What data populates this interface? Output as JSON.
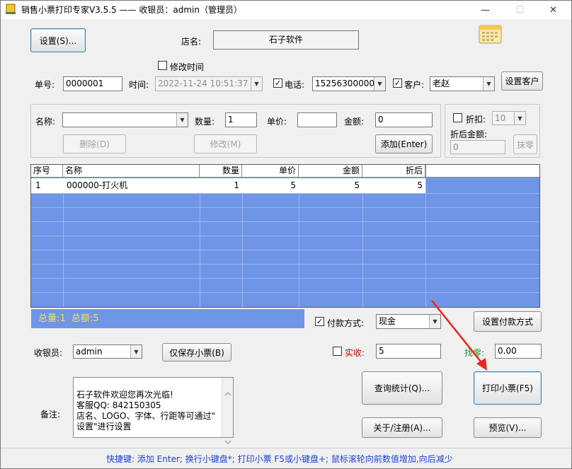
{
  "window": {
    "title": "销售小票打印专家V3.5.5 —— 收银员：admin（管理员）",
    "minimize_glyph": "—",
    "maximize_glyph": "☐",
    "close_glyph": "✕"
  },
  "top": {
    "settings_button": "设置(S)...",
    "store_label": "店名:",
    "store_name": "石子软件",
    "modify_time_label": "修改时间",
    "modify_time_checked": false,
    "order_no_label": "单号:",
    "order_no": "0000001",
    "time_label": "时间:",
    "time_value": "2022-11-24 10:51:37",
    "phone_checked": true,
    "phone_label": "电话:",
    "phone_value": "15256300000",
    "customer_checked": true,
    "customer_label": "客户:",
    "customer_value": "老赵",
    "set_customer_button": "设置客户"
  },
  "item_entry": {
    "name_label": "名称:",
    "name_value": "",
    "qty_label": "数量:",
    "qty_value": "1",
    "price_label": "单价:",
    "price_value": "",
    "amount_label": "金额:",
    "amount_value": "0",
    "delete_button": "删除(D)",
    "modify_button": "修改(M)",
    "add_button": "添加(Enter)",
    "discount_checked": false,
    "discount_label": "折扣:",
    "discount_value": "10",
    "after_discount_label": "折后金额:",
    "after_discount_value": "0",
    "wipe_button": "抹零"
  },
  "grid": {
    "columns": [
      "序号",
      "名称",
      "数量",
      "单价",
      "金额",
      "折后"
    ],
    "rows": [
      {
        "no": "1",
        "name": "000000-打火机",
        "qty": "1",
        "price": "5",
        "amount": "5",
        "discounted": "5"
      }
    ]
  },
  "summary": {
    "text": "总量:1  总额:5"
  },
  "payment": {
    "payment_checked": true,
    "payment_label": "付款方式:",
    "payment_value": "现金",
    "set_payment_button": "设置付款方式",
    "cashier_label": "收银员:",
    "cashier_value": "admin",
    "save_only_button": "仅保存小票(B)",
    "received_checked": false,
    "received_label": "实收:",
    "received_value": "5",
    "change_label": "找零:",
    "change_value": "0.00"
  },
  "actions": {
    "query_button": "查询统计(Q)...",
    "print_button": "打印小票(F5)",
    "about_button": "关于/注册(A)...",
    "preview_button": "预览(V)..."
  },
  "remarks": {
    "label": "备注:",
    "text": "石子软件欢迎您再次光临!\n客服QQ: 842150305\n店名、LOGO、字体、行距等可通过\"\n设置\"进行设置"
  },
  "statusbar": {
    "text": "快捷键: 添加 Enter; 换行小键盘*; 打印小票 F5或小键盘+; 鼠标滚轮向前数值增加,向后减少"
  },
  "colors": {
    "grid_blue": "#6f95e6",
    "summary_text": "#f6e34b",
    "received_label": "#cc0000",
    "change_label": "#1a9a1a",
    "status_text": "#1a3fd3",
    "annotation_arrow": "#e8261c"
  },
  "icons": {
    "app": "receipt-app-icon",
    "calendar": "calendar-icon",
    "dropdown": "chevron-down-icon"
  }
}
